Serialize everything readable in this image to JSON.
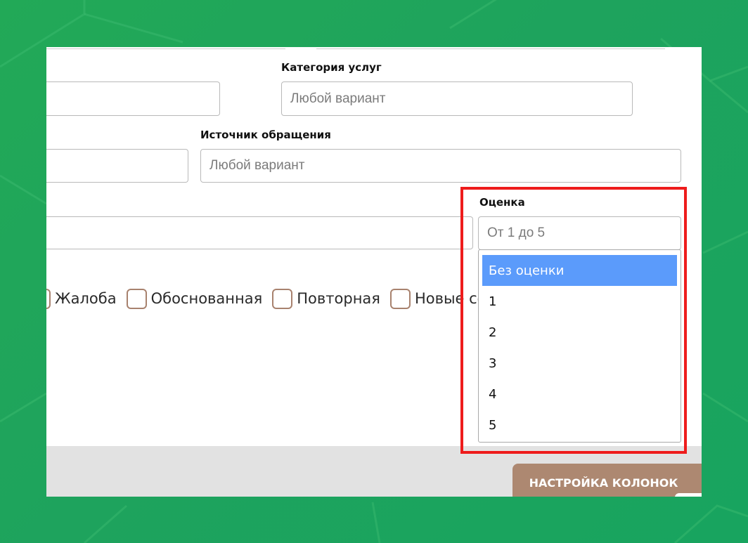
{
  "colors": {
    "background": "#1fa65a",
    "accent_button": "#ad8871",
    "checkbox_border": "#a8826e",
    "selected_option": "#5b9bfb",
    "highlight": "#ee1c1c"
  },
  "filters": {
    "service_category": {
      "label": "Категория услуг",
      "placeholder": "Любой вариант"
    },
    "request_source": {
      "label": "Источник обращения",
      "placeholder": "Любой вариант"
    },
    "rating": {
      "label": "Оценка",
      "placeholder": "От 1 до 5",
      "options": [
        "Без оценки",
        "1",
        "2",
        "3",
        "4",
        "5"
      ],
      "highlighted_option": "Без оценки"
    }
  },
  "checkboxes": [
    {
      "label": "Жалоба",
      "checked": false
    },
    {
      "label": "Обоснованная",
      "checked": false
    },
    {
      "label": "Повторная",
      "checked": false
    },
    {
      "label": "Новые со",
      "checked": false
    }
  ],
  "toolbar": {
    "columns_button": "НАСТРОЙКА КОЛОНОК"
  }
}
